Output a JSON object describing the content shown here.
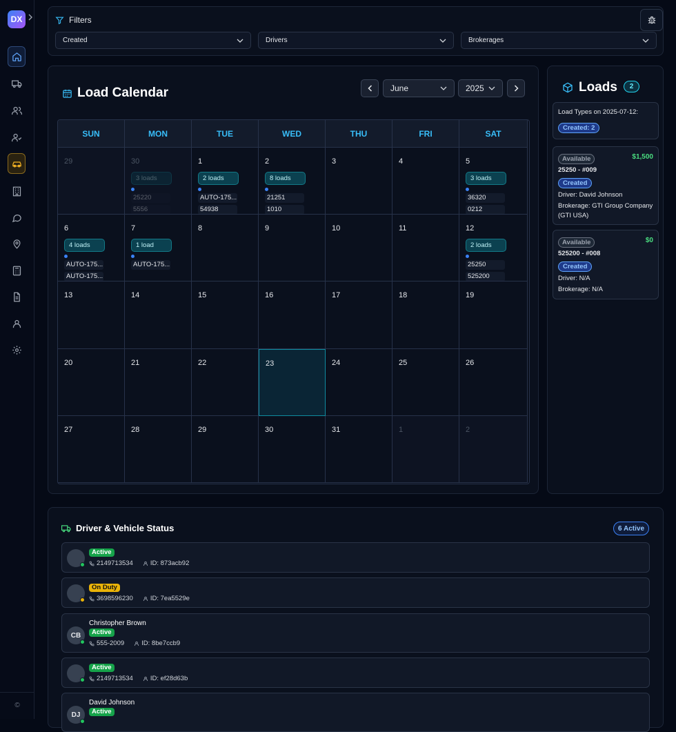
{
  "app": {
    "logo": "DX",
    "copyright": "©"
  },
  "sidebar": {
    "items": [
      {
        "name": "home"
      },
      {
        "name": "truck"
      },
      {
        "name": "users"
      },
      {
        "name": "user-check"
      },
      {
        "name": "car"
      },
      {
        "name": "building"
      },
      {
        "name": "chat"
      },
      {
        "name": "map-pin"
      },
      {
        "name": "calculator"
      },
      {
        "name": "document"
      },
      {
        "name": "user"
      },
      {
        "name": "settings"
      }
    ]
  },
  "filters": {
    "title": "Filters",
    "selects": [
      "Created",
      "Drivers",
      "Brokerages"
    ]
  },
  "calendar": {
    "title": "Load Calendar",
    "month": "June",
    "year": "2025",
    "weekdays": [
      "SUN",
      "MON",
      "TUE",
      "WED",
      "THU",
      "FRI",
      "SAT"
    ],
    "weeks": [
      [
        {
          "d": "29",
          "other": true
        },
        {
          "d": "30",
          "other": true,
          "badge": "3 loads",
          "items": [
            "25220",
            "5556"
          ]
        },
        {
          "d": "1",
          "badge": "2 loads",
          "items": [
            "AUTO-175...",
            "54938"
          ]
        },
        {
          "d": "2",
          "badge": "8 loads",
          "items": [
            "21251",
            "1010"
          ]
        },
        {
          "d": "3"
        },
        {
          "d": "4"
        },
        {
          "d": "5",
          "badge": "3 loads",
          "items": [
            "36320",
            "0212"
          ]
        }
      ],
      [
        {
          "d": "6",
          "badge": "4 loads",
          "items": [
            "AUTO-175...",
            "AUTO-175..."
          ]
        },
        {
          "d": "7",
          "badge": "1 load",
          "items": [
            "AUTO-175..."
          ]
        },
        {
          "d": "8"
        },
        {
          "d": "9"
        },
        {
          "d": "10"
        },
        {
          "d": "11"
        },
        {
          "d": "12",
          "badge": "2 loads",
          "items": [
            "25250",
            "525200"
          ]
        }
      ],
      [
        {
          "d": "13"
        },
        {
          "d": "14"
        },
        {
          "d": "15"
        },
        {
          "d": "16"
        },
        {
          "d": "17"
        },
        {
          "d": "18"
        },
        {
          "d": "19"
        }
      ],
      [
        {
          "d": "20"
        },
        {
          "d": "21"
        },
        {
          "d": "22"
        },
        {
          "d": "23",
          "today": true
        },
        {
          "d": "24"
        },
        {
          "d": "25"
        },
        {
          "d": "26"
        }
      ],
      [
        {
          "d": "27"
        },
        {
          "d": "28"
        },
        {
          "d": "29"
        },
        {
          "d": "30"
        },
        {
          "d": "31"
        },
        {
          "d": "1",
          "other": true
        },
        {
          "d": "2",
          "other": true
        }
      ]
    ]
  },
  "loads": {
    "title": "Loads",
    "count": "2",
    "types_label": "Load Types on 2025-07-12:",
    "types_badge": "Created: 2",
    "cards": [
      {
        "status": "Available",
        "price": "$1,500",
        "id": "25250 - #009",
        "state": "Created",
        "driver": "Driver: David Johnson",
        "brokerage": "Brokerage: GTI Group Company (GTI USA)"
      },
      {
        "status": "Available",
        "price": "$0",
        "id": "525200 - #008",
        "state": "Created",
        "driver": "Driver: N/A",
        "brokerage": "Brokerage: N/A"
      }
    ]
  },
  "drivers": {
    "title": "Driver & Vehicle Status",
    "active_badge": "6 Active",
    "rows": [
      {
        "name": "",
        "initials": "",
        "status": "Active",
        "color": "#22c55e",
        "phone": "2149713534",
        "id": "ID: 873acb92"
      },
      {
        "name": "",
        "initials": "",
        "status": "On Duty",
        "color": "#eab308",
        "phone": "3698596230",
        "id": "ID: 7ea5529e"
      },
      {
        "name": "Christopher Brown",
        "initials": "CB",
        "status": "Active",
        "color": "#22c55e",
        "phone": "555-2009",
        "id": "ID: 8be7ccb9"
      },
      {
        "name": "",
        "initials": "",
        "status": "Active",
        "color": "#22c55e",
        "phone": "2149713534",
        "id": "ID: ef28d63b"
      },
      {
        "name": "David Johnson",
        "initials": "DJ",
        "status": "Active",
        "color": "#22c55e",
        "phone": "",
        "id": ""
      }
    ]
  }
}
